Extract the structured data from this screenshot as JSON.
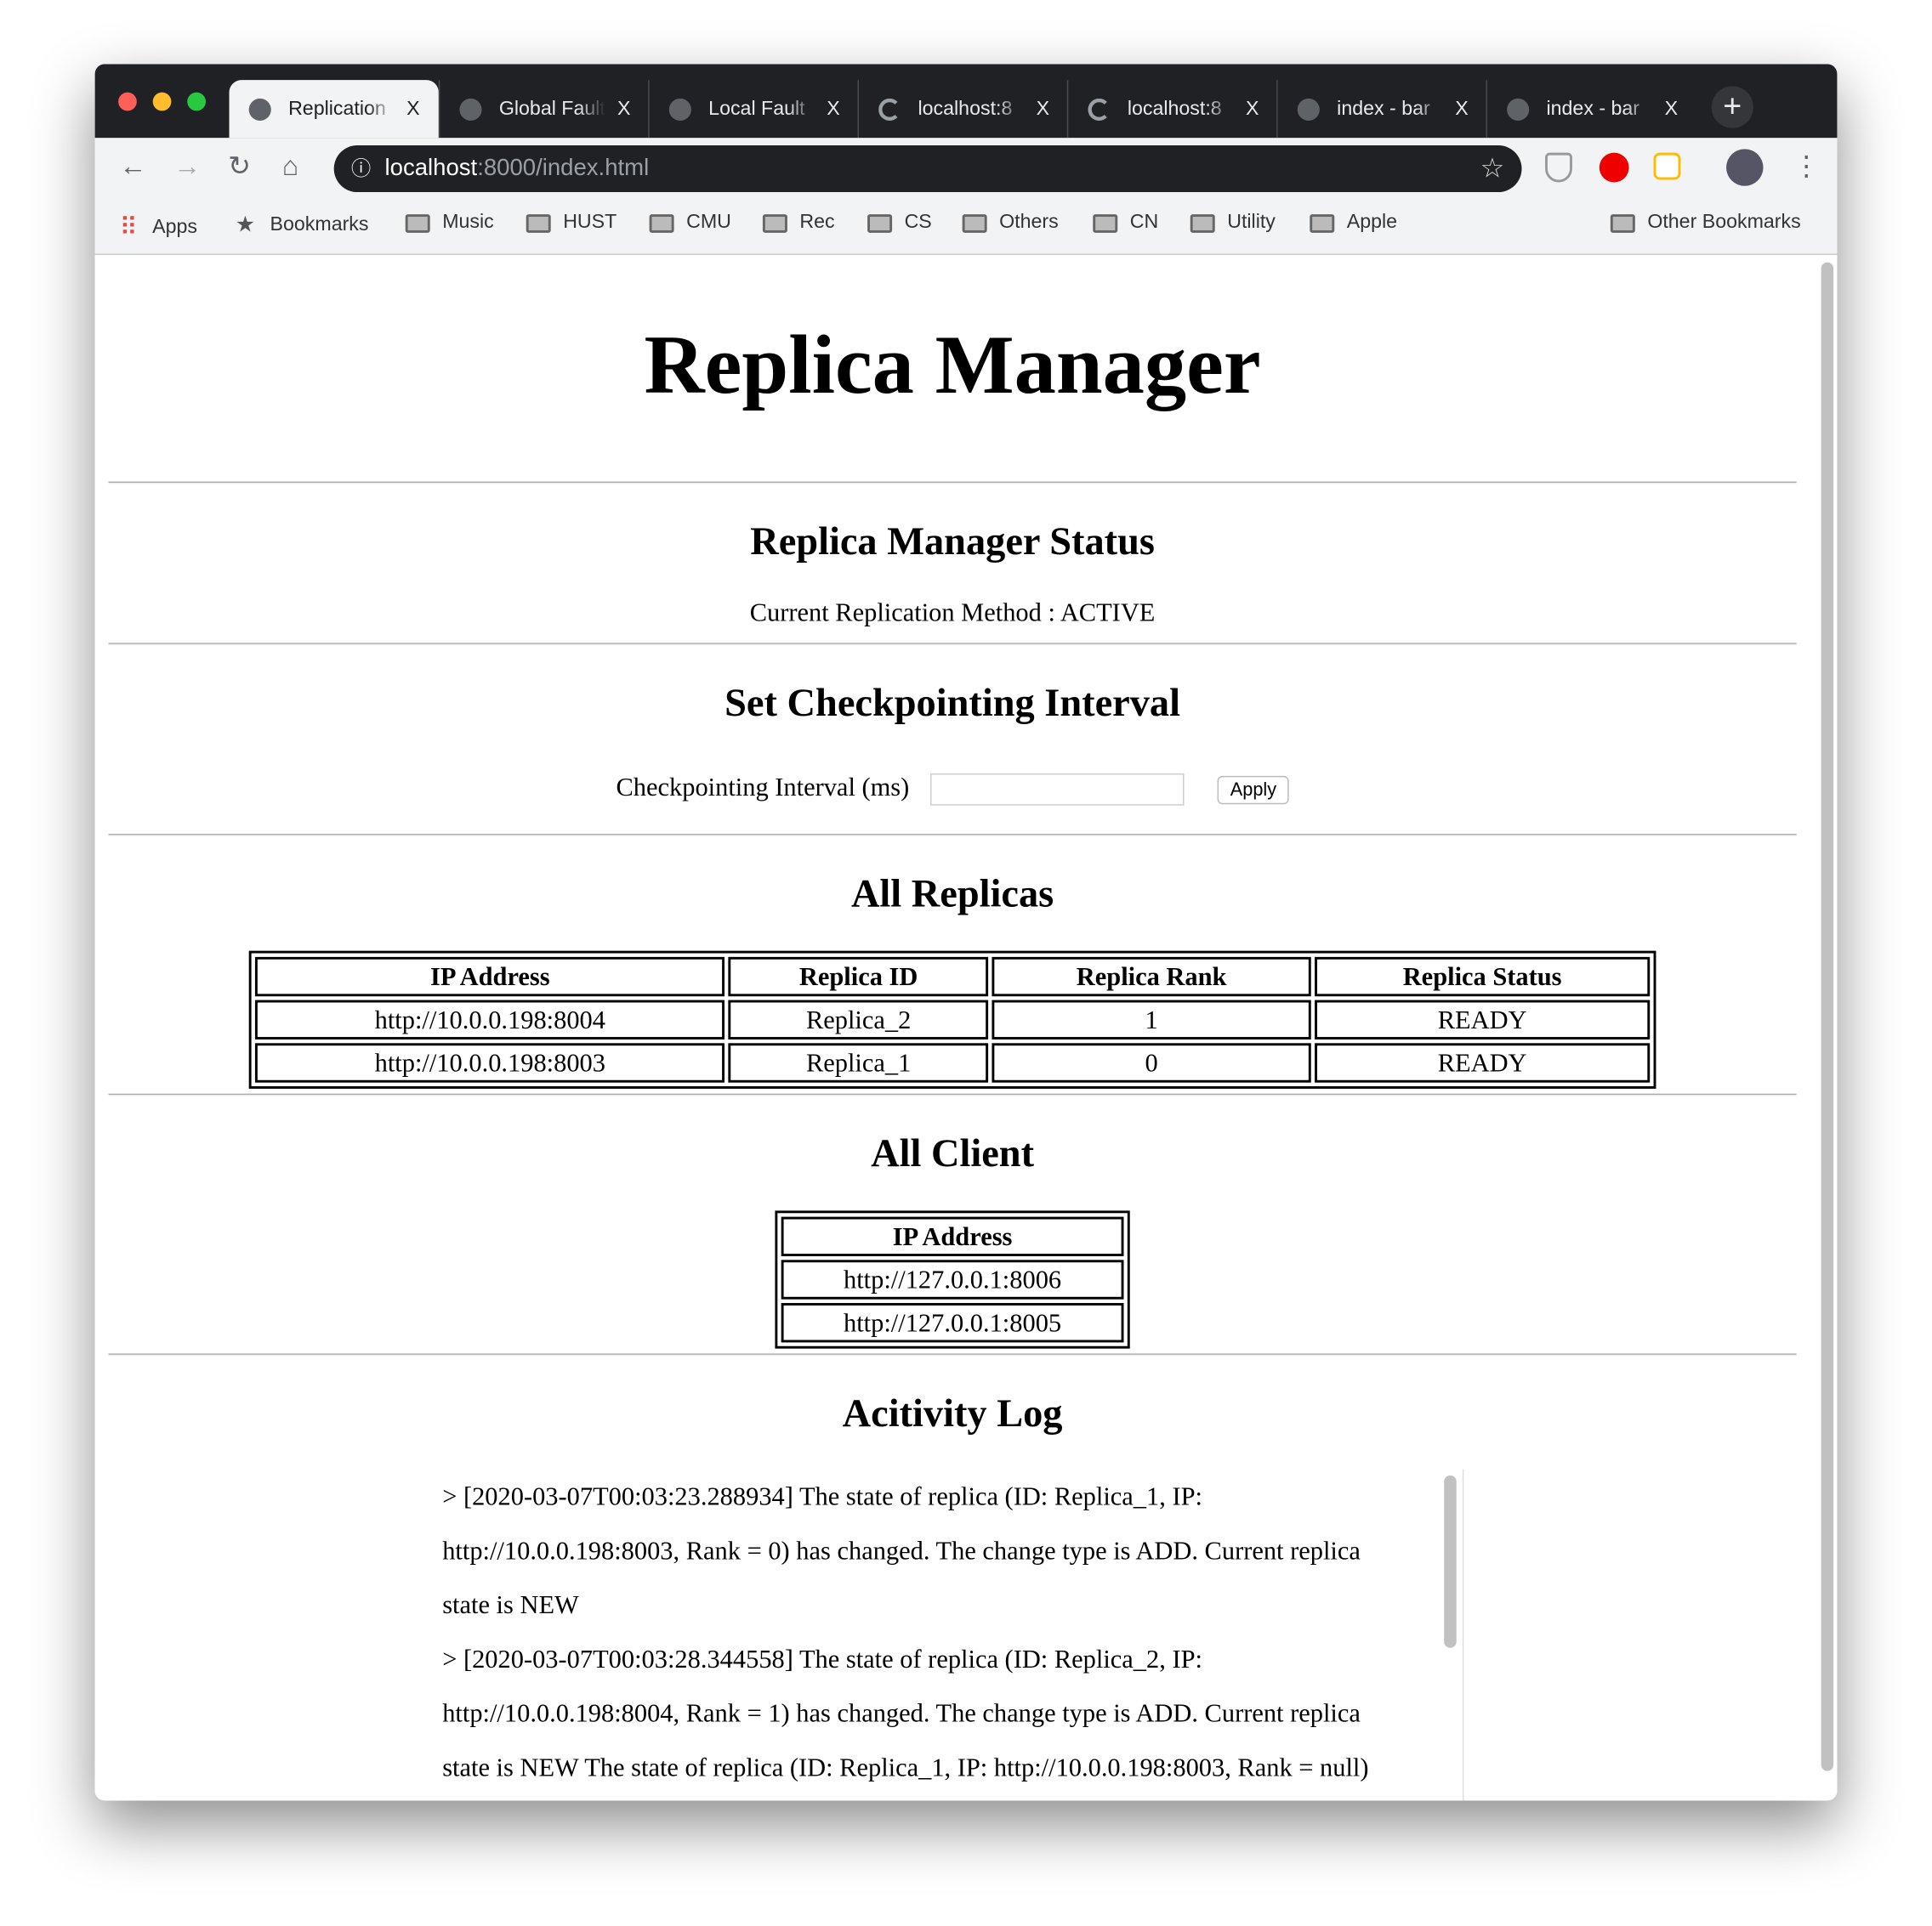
{
  "browser": {
    "tabs": [
      {
        "title": "Replication",
        "active": true,
        "icon": "globe-icon"
      },
      {
        "title": "Global Fault",
        "active": false,
        "icon": "globe-icon"
      },
      {
        "title": "Local Fault",
        "active": false,
        "icon": "globe-icon"
      },
      {
        "title": "localhost:8",
        "active": false,
        "icon": "loading-icon"
      },
      {
        "title": "localhost:8",
        "active": false,
        "icon": "loading-icon"
      },
      {
        "title": "index - bar",
        "active": false,
        "icon": "globe-icon"
      },
      {
        "title": "index - bar",
        "active": false,
        "icon": "globe-icon"
      }
    ],
    "close_glyph": "X",
    "new_tab_glyph": "+",
    "url_host": "localhost",
    "url_rest": ":8000/index.html",
    "bookmarks": [
      "Apps",
      "Bookmarks",
      "Music",
      "HUST",
      "CMU",
      "Rec",
      "CS",
      "Others",
      "CN",
      "Utility",
      "Apple"
    ],
    "other_bookmarks": "Other Bookmarks"
  },
  "page": {
    "title": "Replica Manager",
    "status": {
      "heading": "Replica Manager Status",
      "method_text": "Current Replication Method : ACTIVE"
    },
    "checkpoint": {
      "heading": "Set Checkpointing Interval",
      "label": "Checkpointing Interval (ms)",
      "value": "",
      "apply_label": "Apply"
    },
    "replicas": {
      "heading": "All Replicas",
      "columns": [
        "IP Address",
        "Replica ID",
        "Replica Rank",
        "Replica Status"
      ],
      "rows": [
        [
          "http://10.0.0.198:8004",
          "Replica_2",
          "1",
          "READY"
        ],
        [
          "http://10.0.0.198:8003",
          "Replica_1",
          "0",
          "READY"
        ]
      ]
    },
    "clients": {
      "heading": "All Client",
      "columns": [
        "IP Address"
      ],
      "rows": [
        [
          "http://127.0.0.1:8006"
        ],
        [
          "http://127.0.0.1:8005"
        ]
      ]
    },
    "log": {
      "heading": "Acitivity Log",
      "entries": [
        "> [2020-03-07T00:03:23.288934] The state of replica (ID: Replica_1, IP: http://10.0.0.198:8003, Rank = 0) has changed. The change type is ADD. Current replica state is NEW",
        "> [2020-03-07T00:03:28.344558] The state of replica (ID: Replica_2, IP: http://10.0.0.198:8004, Rank = 1) has changed. The change type is ADD. Current replica state is NEW The state of replica (ID: Replica_1, IP: http://10.0.0.198:8003, Rank = null)"
      ]
    }
  }
}
